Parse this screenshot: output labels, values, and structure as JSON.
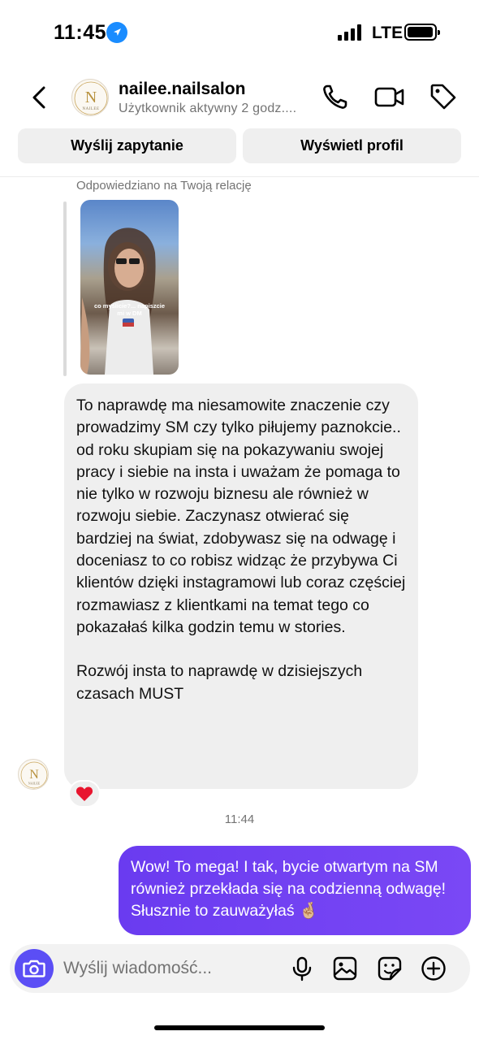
{
  "status_bar": {
    "time": "11:45",
    "network": "LTE"
  },
  "header": {
    "name": "nailee.nailsalon",
    "subtitle": "Użytkownik aktywny 2 godz....",
    "avatar_letter": "N",
    "avatar_text": "NAILEE"
  },
  "actions": {
    "request_label": "Wyślij zapytanie",
    "profile_label": "Wyświetl profil"
  },
  "story": {
    "replied_label": "Odpowiedziano na Twoją relację",
    "caption_line1": "co myślicie?... napiszcie",
    "caption_line2": "mi w DM"
  },
  "incoming_message": {
    "paragraph1": "To naprawdę ma niesamowite znaczenie czy prowadzimy SM czy tylko piłujemy paznokcie.. od roku skupiam się na pokazywaniu swojej pracy i siebie na insta i uważam że pomaga to nie tylko w rozwoju biznesu ale również w rozwoju siebie. Zaczynasz otwierać się bardziej na świat, zdobywasz się na odwagę i doceniasz to co robisz widząc że przybywa Ci klientów dzięki instagramowi lub coraz częściej rozmawiasz z klientkami na temat tego co pokazałaś kilka godzin temu w stories.",
    "paragraph2": "Rozwój insta to naprawdę w dzisiejszych czasach MUST",
    "reaction": "❤️"
  },
  "timestamp": "11:44",
  "outgoing_message": {
    "text": "Wow! To mega! I tak, bycie otwartym na SM również przekłada się na codzienną odwagę! Słusznie to zauważyłaś",
    "emoji": "🤞🏼"
  },
  "composer": {
    "placeholder": "Wyślij wiadomość..."
  },
  "colors": {
    "accent": "#6c3ff5",
    "camera": "#5b4ef5",
    "bubble_in": "#efefef"
  }
}
